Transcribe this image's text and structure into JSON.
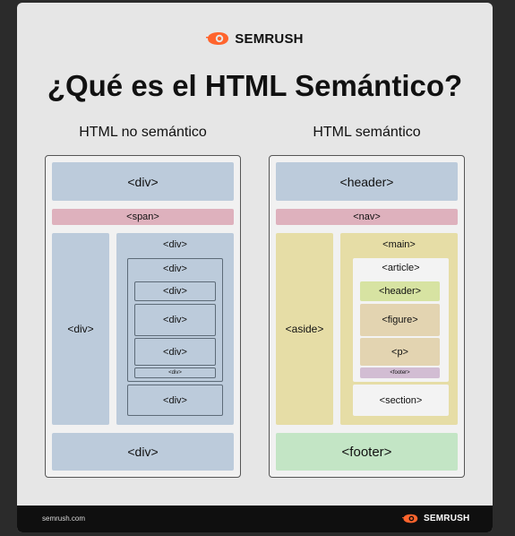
{
  "brand": {
    "name": "SEMRUSH",
    "site": "semrush.com",
    "accent": "#ff642d"
  },
  "title": "¿Qué es el HTML Semántico?",
  "left_panel": {
    "heading": "HTML no semántico",
    "top": "<div>",
    "span": "<span>",
    "side": "<div>",
    "right_col": "<div>",
    "inner_box": "<div>",
    "nested": [
      "<div>",
      "<div>",
      "<div>"
    ],
    "tiny": "<div>",
    "lower_box": "<div>",
    "bottom": "<div>"
  },
  "right_panel": {
    "heading": "HTML semántico",
    "header": "<header>",
    "nav": "<nav>",
    "aside": "<aside>",
    "main": "<main>",
    "article": "<article>",
    "article_header": "<header>",
    "figure": "<figure>",
    "p": "<p>",
    "article_footer": "<footer>",
    "section": "<section>",
    "footer": "<footer>"
  }
}
